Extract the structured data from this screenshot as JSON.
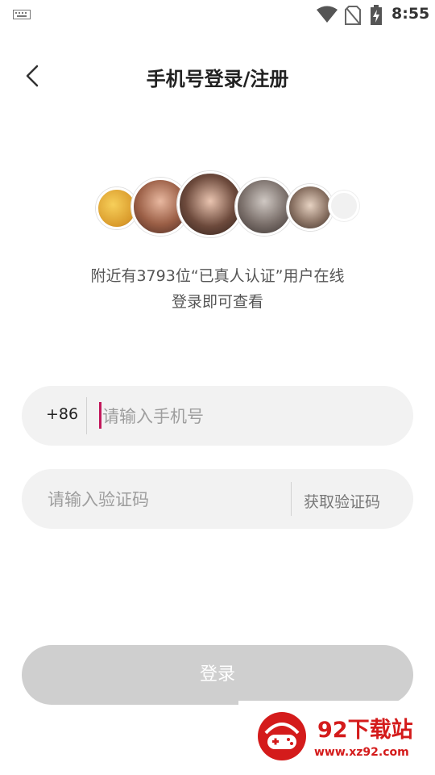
{
  "status_bar": {
    "time": "8:55",
    "icons": [
      "keyboard-icon",
      "wifi-icon",
      "no-sim-icon",
      "battery-charging-icon"
    ]
  },
  "header": {
    "back_icon": "chevron-left-icon",
    "title": "手机号登录/注册"
  },
  "nearby": {
    "line1": "附近有3793位“已真人认证”用户在线",
    "line2": "登录即可查看"
  },
  "avatars": [
    "avatar-1",
    "avatar-2",
    "avatar-3",
    "avatar-4",
    "avatar-5",
    "avatar-6"
  ],
  "phone_field": {
    "country_code": "+86",
    "placeholder": "请输入手机号",
    "value": ""
  },
  "code_field": {
    "placeholder": "请输入验证码",
    "value": "",
    "get_code_label": "获取验证码"
  },
  "login_button": {
    "label": "登录"
  },
  "watermark": {
    "title": "92下载站",
    "url": "www.xz92.com"
  },
  "colors": {
    "accent": "#c2185b",
    "field_bg": "#f2f2f2",
    "button_disabled": "#cfcfcf",
    "watermark_red": "#d41b1b"
  }
}
